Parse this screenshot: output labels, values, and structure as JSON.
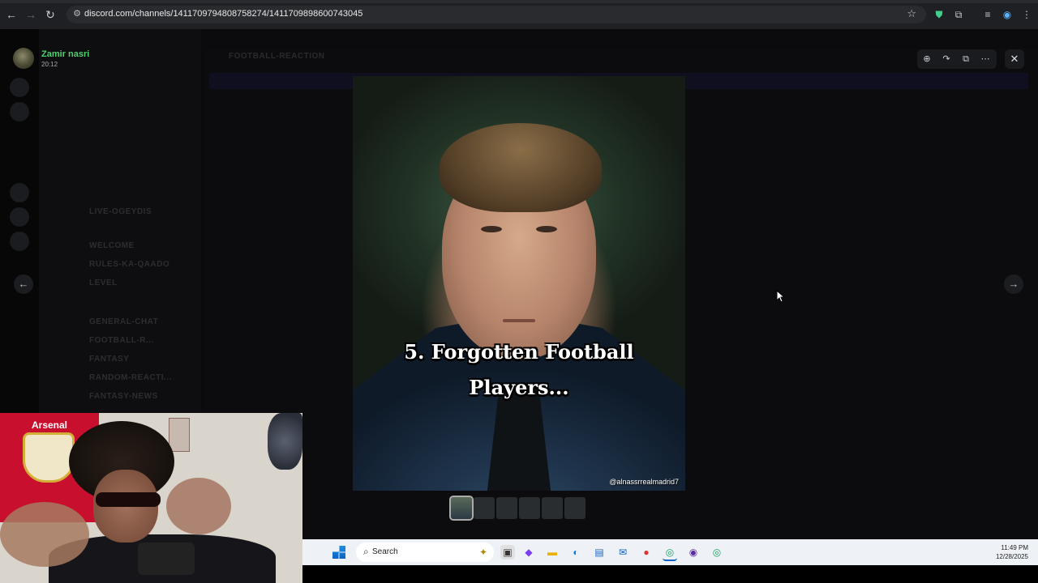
{
  "browser": {
    "url": "discord.com/channels/1411709794808758274/1411709898600743045"
  },
  "discord": {
    "channel_title": "FOOTBALL-REACTION",
    "channels": [
      "GENERAL-CHAT",
      "FOOTBALL-R...",
      "FANTASY",
      "RANDOM-REACTI...",
      "FANTASY-NEWS",
      "WELCOME",
      "RULES-KA-QAADO",
      "LEVEL",
      "LIVE-OGEYDIS"
    ]
  },
  "viewer": {
    "user_name": "Zamir nasri",
    "user_time": "20:12",
    "image_caption_line1": "5. Forgotten Football",
    "image_caption_line2": "Players...",
    "watermark": "@alnassrrealmadrid7",
    "thumbnail_count": 6
  },
  "webcam": {
    "flag_text": "Arsenal"
  },
  "taskbar": {
    "search_label": "Search",
    "time": "11:49 PM",
    "date": "12/28/2025"
  },
  "colors": {
    "username": "#4fd06e",
    "taskbar_bg": "#eef1f6"
  }
}
